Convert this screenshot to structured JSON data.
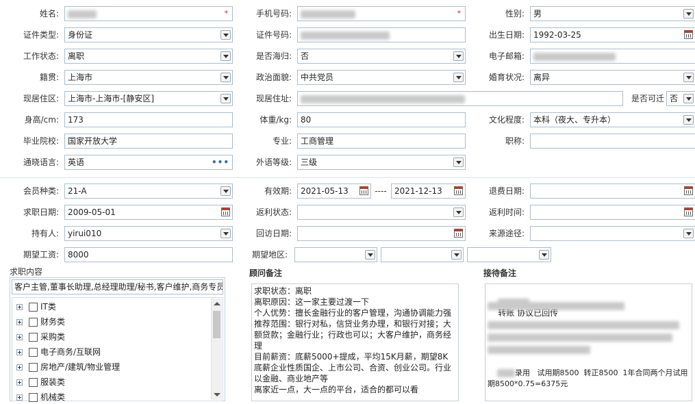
{
  "basic": {
    "name_label": "姓名:",
    "phone_label": "手机号码:",
    "gender_label": "性别:",
    "gender_value": "男",
    "idtype_label": "证件类型:",
    "idtype_value": "身份证",
    "idno_label": "证件号码:",
    "birth_label": "出生日期:",
    "birth_value": "1992-03-25",
    "work_label": "工作状态:",
    "work_value": "离职",
    "overseas_label": "是否海归:",
    "overseas_value": "否",
    "email_label": "电子邮箱:",
    "native_label": "籍贯:",
    "native_value": "上海市",
    "political_label": "政治面貌:",
    "political_value": "中共党员",
    "marital_label": "婚育状况:",
    "marital_value": "离异",
    "residence_label": "现居住区:",
    "residence_value": "上海市-上海市-[静安区]",
    "address_label": "现居住址:",
    "relocate_label": "是否可迁",
    "relocate_value": "否",
    "height_label": "身高/cm:",
    "height_value": "173",
    "weight_label": "体重/kg:",
    "weight_value": "80",
    "edu_label": "文化程度:",
    "edu_value": "本科（夜大、专升本）",
    "school_label": "毕业院校:",
    "school_value": "国家开放大学",
    "major_label": "专业:",
    "major_value": "工商管理",
    "title_label": "职称:",
    "lang_label": "通晓语言:",
    "lang_value": "英语",
    "lang_level_label": "外语等级:",
    "lang_level_value": "三级"
  },
  "member": {
    "type_label": "会员种类:",
    "type_value": "21-A",
    "valid_label": "有效期:",
    "valid_from": "2021-05-13",
    "valid_sep": "----",
    "valid_to": "2021-12-13",
    "refund_label": "退费日期:",
    "jobdate_label": "求职日期:",
    "jobdate_value": "2009-05-01",
    "rebate_status_label": "返利状态:",
    "rebate_time_label": "返利时间:",
    "holder_label": "持有人:",
    "holder_value": "yirui010",
    "revisit_label": "回访日期:",
    "source_label": "来源途径:",
    "salary_label": "期望工资:",
    "salary_value": "8000",
    "region_label": "期望地区:"
  },
  "job_content": {
    "title": "求职内容",
    "selected": "客户主管,董事长助理,总经理助理/秘书,客户维护,商务专员",
    "categories": [
      "IT类",
      "财务类",
      "采购类",
      "电子商务/互联网",
      "房地产/建筑/物业管理",
      "服装类",
      "机械类"
    ]
  },
  "advisor_note": {
    "title": "顾问备注",
    "lines": [
      "求职状态：离职",
      "离职原因：这一家主要过渡一下",
      "个人优势：擅长金融行业的客户管理，沟通协调能力强",
      "推荐范围：银行对私，信贷业务办理，和银行对接；大额贷款；金融行业；行政也可以；大客户维护，商务经理",
      "目前薪资：底薪5000+提成，平均15K月薪，期望8K底薪企业性质国企、上市公司、合资、创业公司。行业以金融、商业地产等",
      "离家近一点，大一点的平台，适合的都可以看"
    ]
  },
  "reception_note": {
    "title": "接待备注",
    "line1": "转账 协议已回传",
    "line2": "录用   试用期8500  转正8500  1年合同两个月试用期8500*0.75=6375元"
  },
  "colors": {
    "border": "#a9bdcf",
    "required": "#e0262a",
    "accent": "#2e6db4"
  }
}
